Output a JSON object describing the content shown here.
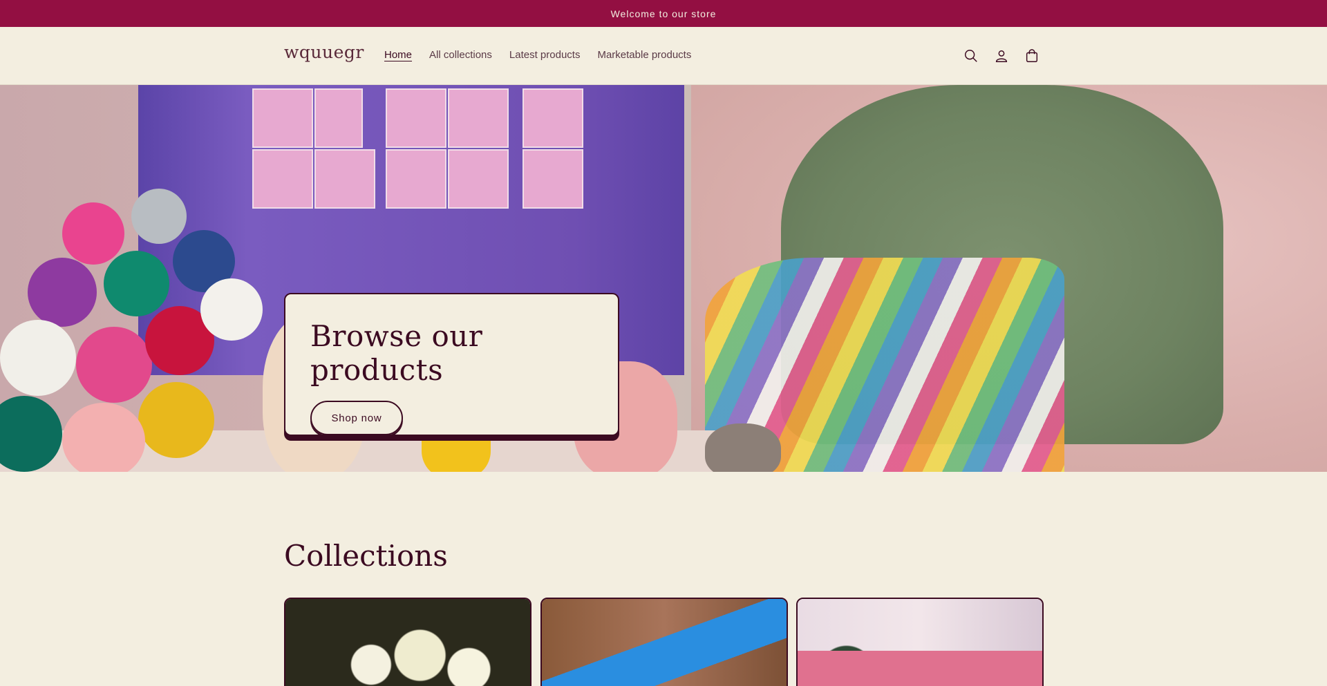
{
  "announcement": {
    "text": "Welcome to our store"
  },
  "header": {
    "logo": "wquuegr",
    "nav": [
      "Home",
      "All collections",
      "Latest products",
      "Marketable products"
    ],
    "icons": [
      "search-icon",
      "account-icon",
      "cart-icon"
    ]
  },
  "hero": {
    "heading": "Browse our products",
    "button_label": "Shop now"
  },
  "collections": {
    "title": "Collections",
    "cards": [
      "flowers-collection",
      "games-collection",
      "advent-collection"
    ]
  },
  "colors": {
    "announcement_bg": "#930f42",
    "background": "#f3eee0",
    "text": "#3b0a21"
  }
}
